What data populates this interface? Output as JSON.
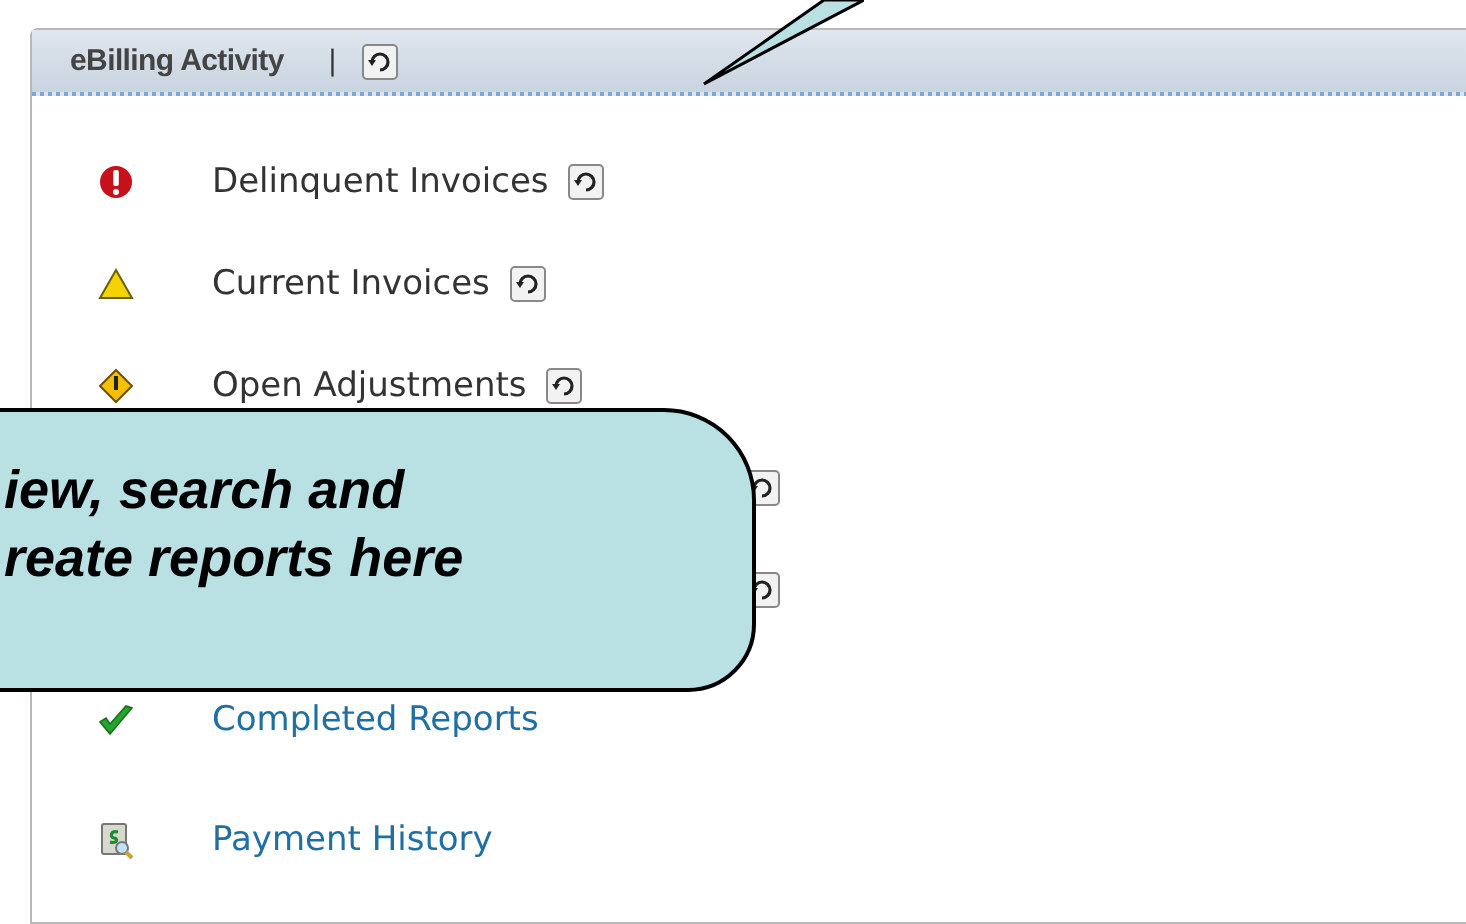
{
  "panel": {
    "title": "eBilling Activity",
    "separator": "|",
    "refresh": true
  },
  "items": [
    {
      "kind": "error",
      "label": "Delinquent Invoices",
      "link": false,
      "refresh": true
    },
    {
      "kind": "warning",
      "label": "Current Invoices",
      "link": false,
      "refresh": true
    },
    {
      "kind": "caution",
      "label": "Open Adjustments",
      "link": false,
      "refresh": true
    },
    {
      "kind": "covered",
      "refresh": true
    },
    {
      "kind": "covered",
      "refresh": true
    },
    {
      "kind": "check",
      "label": "Completed Reports",
      "link": true,
      "refresh": false
    },
    {
      "kind": "payment",
      "label": "Payment History",
      "link": true,
      "refresh": false
    }
  ],
  "callout": {
    "text": "iew, search and reate reports here"
  }
}
